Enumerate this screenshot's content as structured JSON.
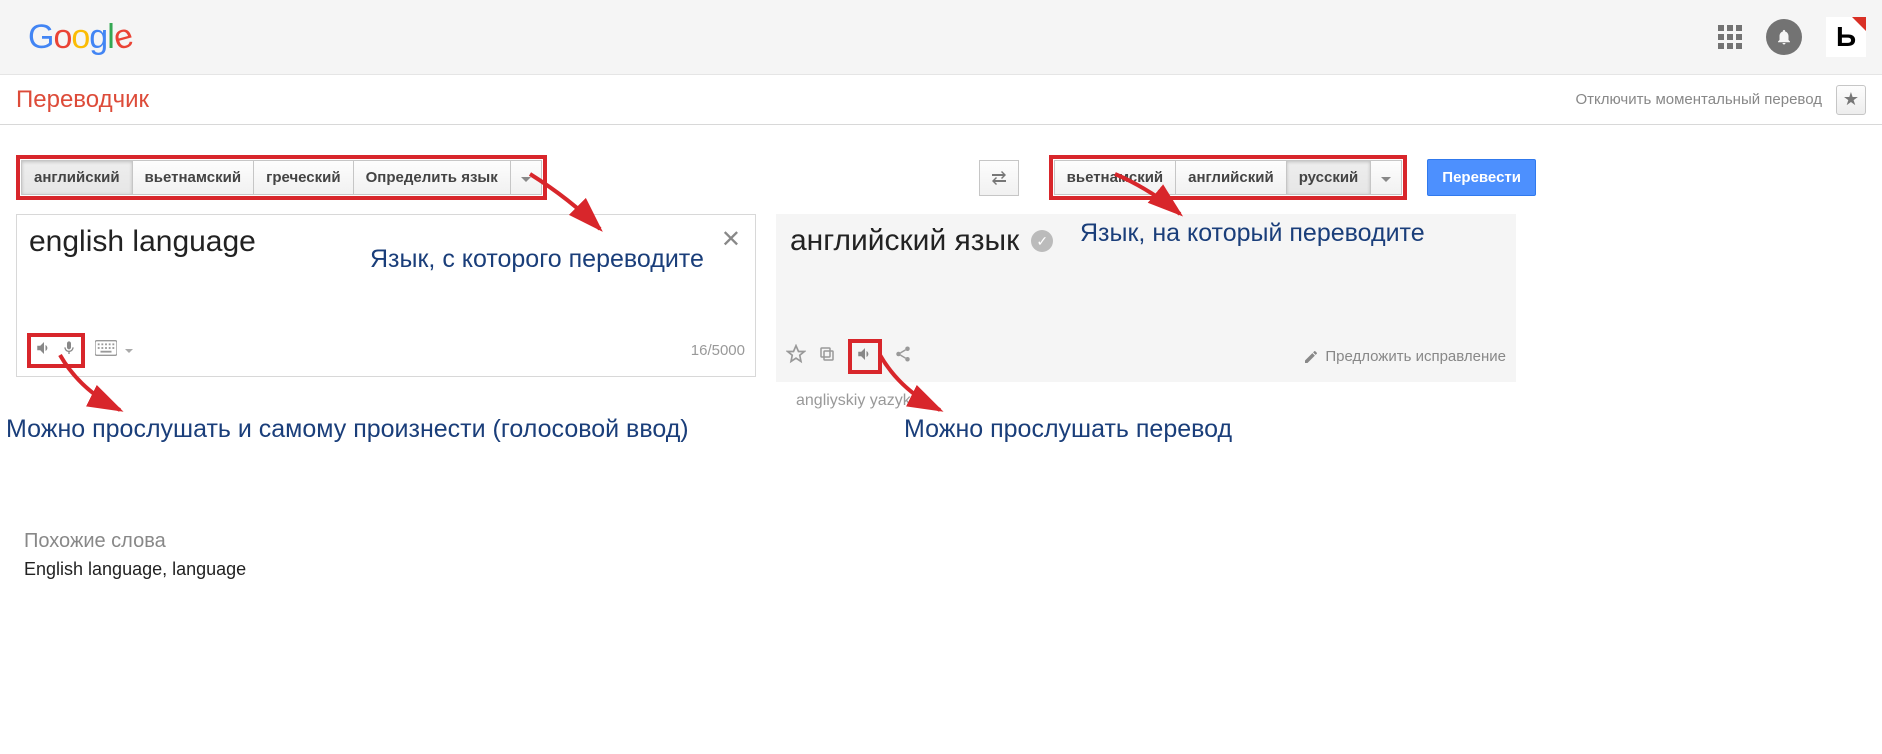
{
  "header": {
    "apps_icon": "apps",
    "bell_icon": "notifications"
  },
  "subheader": {
    "title": "Переводчик",
    "instant_off": "Отключить моментальный перевод"
  },
  "source_langs": {
    "items": [
      "английский",
      "вьетнамский",
      "греческий",
      "Определить язык"
    ],
    "active_index": 0
  },
  "target_langs": {
    "items": [
      "вьетнамский",
      "английский",
      "русский"
    ],
    "active_index": 2
  },
  "translate_btn": "Перевести",
  "source": {
    "text": "english language",
    "char_count": "16/5000"
  },
  "target": {
    "text": "английский язык",
    "translit": "angliyskiy yazyk",
    "suggest": "Предложить исправление"
  },
  "annotations": {
    "src_lang": "Язык, с которого переводите",
    "tgt_lang": "Язык, на который переводите",
    "listen_speak": "Можно прослушать и самому произнести (голосовой ввод)",
    "listen_translation": "Можно прослушать перевод"
  },
  "similar": {
    "title": "Похожие слова",
    "words": "English language, language"
  }
}
